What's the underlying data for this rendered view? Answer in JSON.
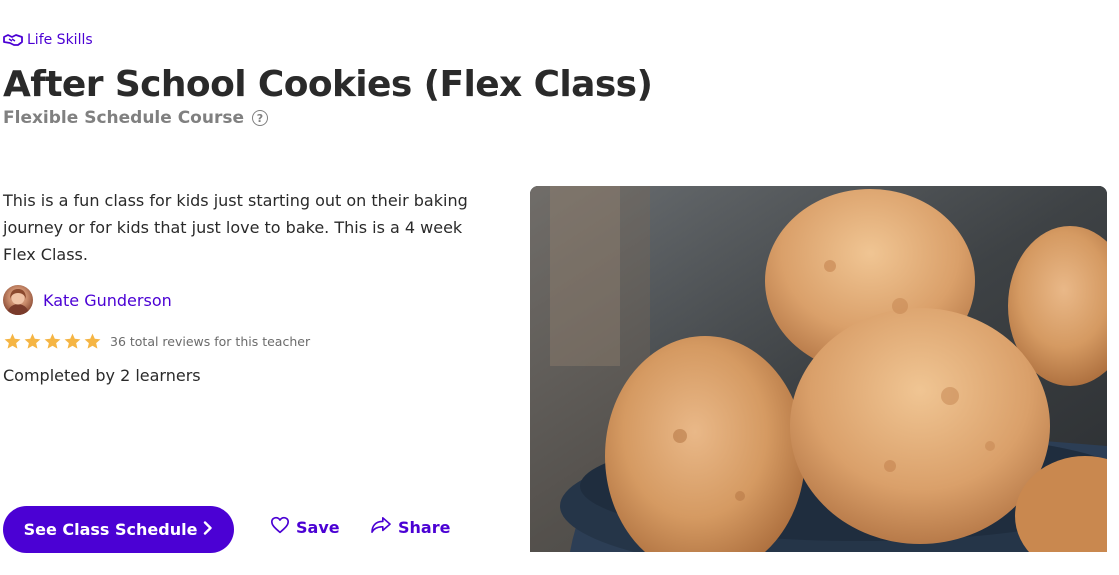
{
  "category": {
    "label": "Life Skills",
    "icon": "handshake-icon"
  },
  "class": {
    "title": "After School Cookies (Flex Class)",
    "format": "Flexible Schedule Course",
    "description": "This is a fun class for kids just starting out on their baking journey or for kids that just love to bake. This is a 4 week Flex Class."
  },
  "teacher": {
    "name": "Kate Gunderson",
    "rating": 5,
    "reviews_text": "36 total reviews for this teacher"
  },
  "stats": {
    "completed_text": "Completed by 2 learners"
  },
  "actions": {
    "schedule_label": "See Class Schedule",
    "save_label": "Save",
    "share_label": "Share"
  },
  "colors": {
    "brand": "#4b01d4",
    "star": "#f5b544",
    "subtitle": "#808080"
  }
}
